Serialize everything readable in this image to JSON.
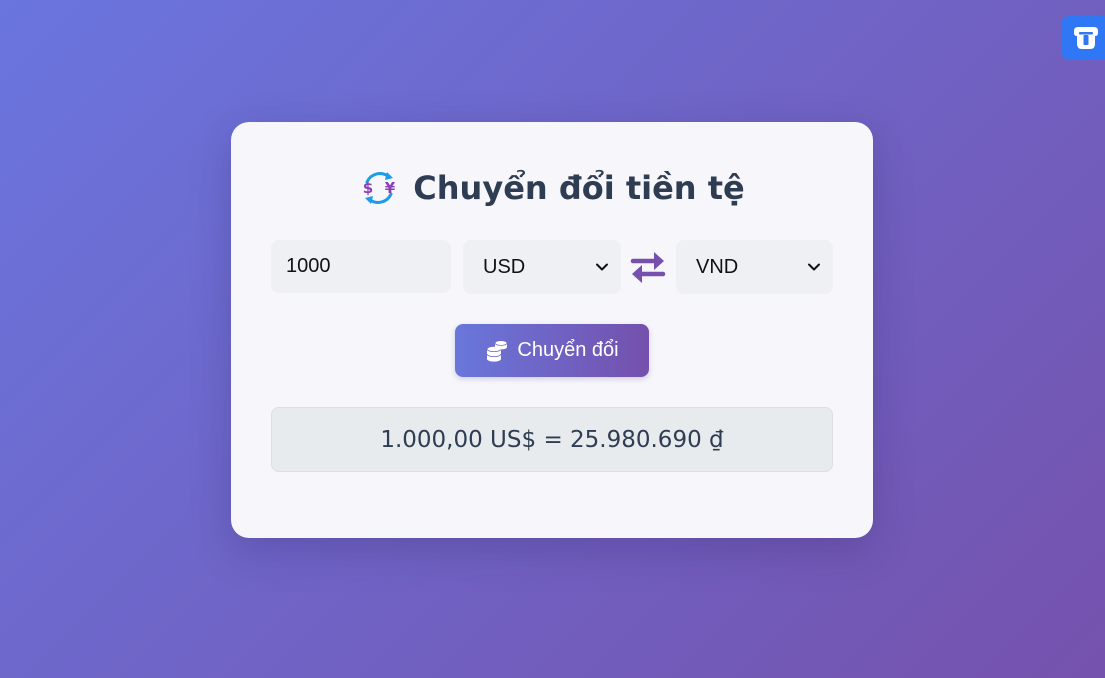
{
  "converter": {
    "title": "Chuyển đổi tiền tệ",
    "title_icon": "currency-exchange-icon",
    "amount_value": "1000",
    "from_currency": "USD",
    "to_currency": "VND",
    "swap_icon": "swap-arrows-icon",
    "convert_label": "Chuyển đổi",
    "convert_icon": "coins-icon",
    "result_text": "1.000,00 US$ = 25.980.690 ₫"
  },
  "extension": {
    "icon": "extension-icon"
  },
  "colors": {
    "background_start": "#6a75de",
    "background_end": "#7552ad",
    "card": "#f6f6fb",
    "title_text": "#2f3d52",
    "accent": "#7550ad",
    "extension": "#2f77f5"
  }
}
